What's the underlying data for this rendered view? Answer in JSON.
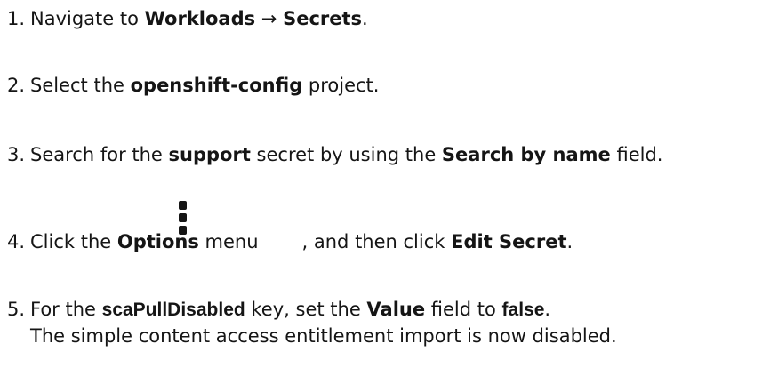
{
  "steps": [
    {
      "number": "1.",
      "parts": [
        "Navigate to ",
        "Workloads",
        " → ",
        "Secrets",
        "."
      ]
    },
    {
      "number": "2.",
      "parts": [
        "Select the ",
        "openshift-config",
        " project."
      ]
    },
    {
      "number": "3.",
      "parts": [
        "Search for the ",
        "support",
        " secret by using the ",
        "Search by name",
        " field."
      ]
    },
    {
      "number": "4.",
      "parts": [
        "Click the ",
        "Options",
        " menu",
        ", and then click ",
        "Edit Secret",
        "."
      ],
      "icon": "kebab-menu-icon"
    },
    {
      "number": "5.",
      "parts": [
        "For the ",
        "scaPullDisabled",
        " key, set the ",
        "Value",
        " field to ",
        "false",
        "."
      ],
      "continuation": "The simple content access entitlement import is now disabled."
    }
  ]
}
